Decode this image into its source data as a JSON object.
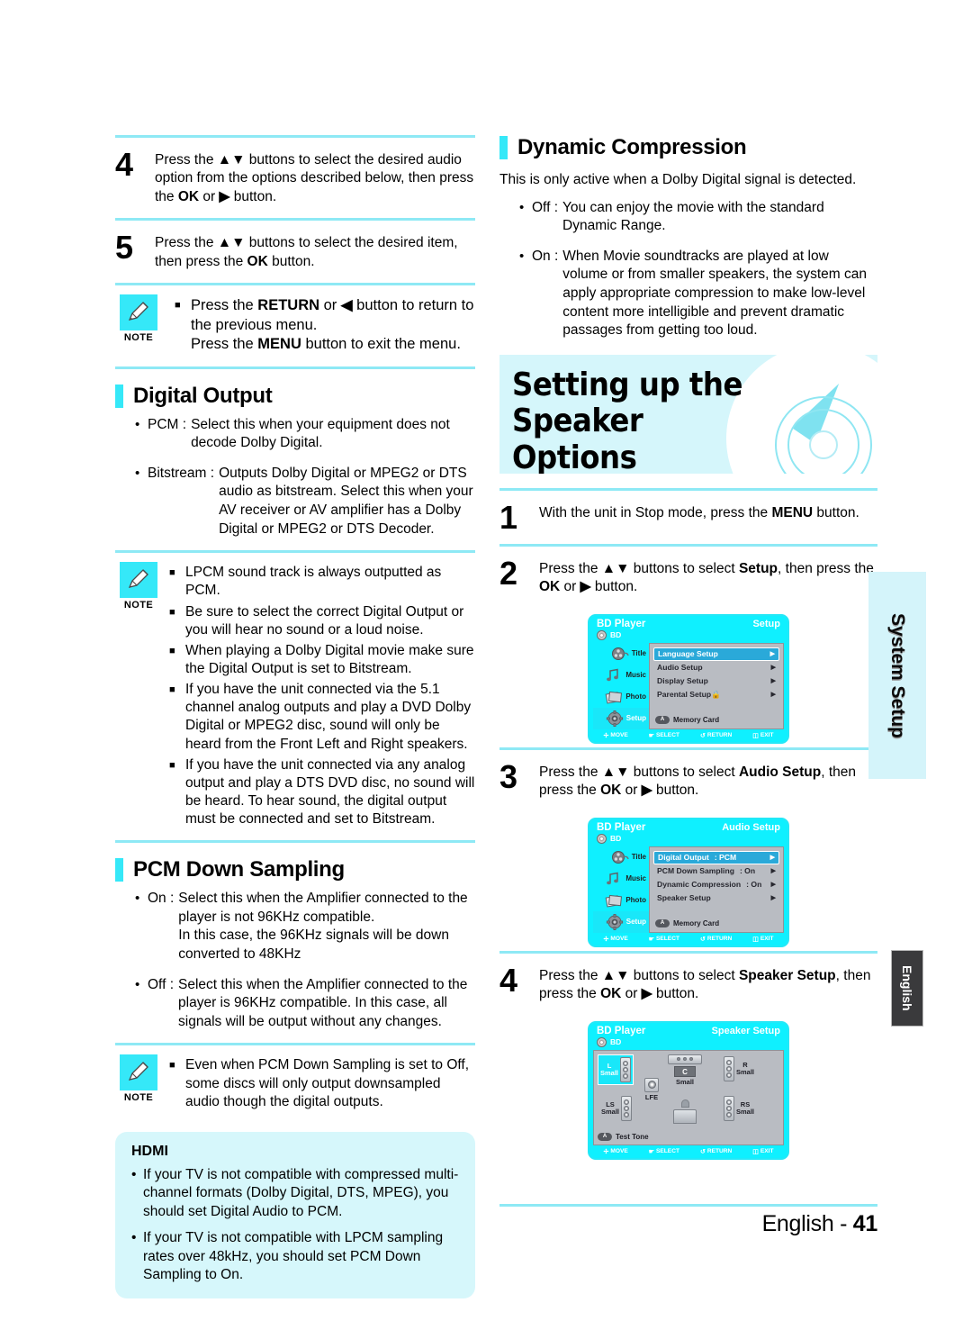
{
  "left_column": {
    "steps": [
      {
        "num": "4",
        "text_parts": [
          "Press the ",
          "▲▼",
          " buttons to select the desired audio option from the options described below, then press the ",
          "OK",
          " or ",
          "▶",
          " button."
        ]
      },
      {
        "num": "5",
        "text_parts": [
          "Press the ",
          "▲▼",
          " buttons to select the desired item, then press the ",
          "OK",
          " button."
        ]
      }
    ],
    "note1": {
      "label": "NOTE",
      "items": [
        "Press the RETURN or ◀ button to return to the previous menu.\nPress the MENU button to exit the menu."
      ]
    },
    "digital_output": {
      "heading": "Digital Output",
      "items": [
        {
          "term": "PCM :",
          "desc": "Select this when your equipment does not decode Dolby Digital."
        },
        {
          "term": "Bitstream :",
          "desc": "Outputs Dolby Digital or MPEG2 or DTS audio as bitstream. Select this when your AV receiver or AV amplifier has a Dolby Digital or MPEG2 or DTS Decoder."
        }
      ]
    },
    "note2": {
      "label": "NOTE",
      "items": [
        "LPCM sound track is always outputted as PCM.",
        "Be sure to select the correct Digital Output or you will hear no sound or a loud noise.",
        "When playing a Dolby Digital movie make sure the Digital Output is set to Bitstream.",
        "If you have the unit connected via the 5.1 channel analog outputs and play a DVD Dolby Digital or MPEG2 disc, sound will only be heard from the Front Left and Right speakers.",
        "If you have the unit connected via any analog output and play a DTS DVD disc, no sound will be heard. To hear sound, the digital output must be connected and set to Bitstream."
      ]
    },
    "pcm_down_sampling": {
      "heading": "PCM Down Sampling",
      "items": [
        {
          "term": "On :",
          "desc": "Select this when the Amplifier connected to the player is not 96KHz compatible.\nIn this case, the 96KHz signals will be down converted to 48KHz"
        },
        {
          "term": "Off :",
          "desc": "Select this when the Amplifier connected to the player is 96KHz compatible. In this case, all signals will be output without any changes."
        }
      ]
    },
    "note3": {
      "label": "NOTE",
      "items": [
        "Even when PCM Down Sampling is set to Off, some discs will only output downsampled audio though the digital outputs."
      ]
    },
    "hdmi_box": {
      "title": "HDMI",
      "items": [
        "If your TV is not compatible with compressed multi-channel formats (Dolby Digital, DTS, MPEG), you should set Digital Audio to PCM.",
        "If your TV is not compatible with LPCM sampling rates over 48kHz, you should set PCM Down Sampling to On."
      ]
    }
  },
  "right_column": {
    "dynamic_compression": {
      "heading": "Dynamic Compression",
      "intro": "This is only active when a Dolby Digital signal is detected.",
      "items": [
        {
          "term": "Off :",
          "desc": "You can enjoy the movie with the standard Dynamic Range."
        },
        {
          "term": "On :",
          "desc": "When Movie soundtracks are played at low volume or from smaller speakers, the system can apply appropriate compression to make low-level content more intelligible and prevent dramatic passages from getting too loud."
        }
      ]
    },
    "banner": {
      "title_line1": "Setting up the Speaker",
      "title_line2": "Options",
      "bg_color": "#d5f6fb"
    },
    "steps": [
      {
        "num": "1",
        "text_parts": [
          "With the unit in Stop mode, press the ",
          "MENU",
          " button."
        ]
      },
      {
        "num": "2",
        "text_parts": [
          "Press the ",
          "▲▼",
          " buttons to select ",
          "Setup",
          ", then press the ",
          "OK",
          " or ",
          "▶",
          " button."
        ]
      },
      {
        "num": "3",
        "text_parts": [
          "Press the ",
          "▲▼",
          " buttons to select ",
          "Audio Setup",
          ", then press the ",
          "OK",
          " or ",
          "▶",
          " button."
        ]
      },
      {
        "num": "4",
        "text_parts": [
          "Press the ",
          "▲▼",
          " buttons to select ",
          "Speaker Setup",
          ", then press the ",
          "OK",
          " or ",
          "▶",
          " button."
        ]
      }
    ]
  },
  "osd_common": {
    "device_title": "BD Player",
    "disc_label": "BD",
    "sidebar": [
      {
        "label": "Title",
        "icon": "film-reel-icon",
        "active": false
      },
      {
        "label": "Music",
        "icon": "music-note-icon",
        "active": false
      },
      {
        "label": "Photo",
        "icon": "photo-stack-icon",
        "active": false
      },
      {
        "label": "Setup",
        "icon": "gear-icon",
        "active": true
      }
    ],
    "memory_card": {
      "button": "A",
      "label": "Memory Card"
    },
    "footer": [
      {
        "icon": "dpad-icon",
        "label": "MOVE"
      },
      {
        "icon": "select-icon",
        "label": "SELECT"
      },
      {
        "icon": "return-icon",
        "label": "RETURN"
      },
      {
        "icon": "exit-icon",
        "label": "EXIT"
      }
    ]
  },
  "osd_setup": {
    "screen_title": "Setup",
    "rows": [
      {
        "name": "Language Setup",
        "value": "",
        "selected": true
      },
      {
        "name": "Audio Setup",
        "value": "",
        "selected": false
      },
      {
        "name": "Display Setup",
        "value": "",
        "selected": false
      },
      {
        "name": "Parental Setup",
        "value": "",
        "selected": false,
        "lock": true
      }
    ]
  },
  "osd_audio": {
    "screen_title": "Audio Setup",
    "rows": [
      {
        "name": "Digital Output",
        "value": ": PCM",
        "selected": true
      },
      {
        "name": "PCM Down Sampling",
        "value": ": On",
        "selected": false
      },
      {
        "name": "Dynamic Compression",
        "value": ": On",
        "selected": false
      },
      {
        "name": "Speaker Setup",
        "value": "",
        "selected": false
      }
    ]
  },
  "osd_speaker": {
    "screen_title": "Speaker Setup",
    "speakers": [
      {
        "id": "L",
        "label": "L\nSmall",
        "highlight": true
      },
      {
        "id": "C",
        "label": "Small",
        "center_letter": "C",
        "highlight": false
      },
      {
        "id": "R",
        "label": "R\nSmall",
        "highlight": false
      },
      {
        "id": "LS",
        "label": "LS\nSmall",
        "highlight": false
      },
      {
        "id": "LFE",
        "label": "LFE",
        "highlight": false
      },
      {
        "id": "RS",
        "label": "RS\nSmall",
        "highlight": false
      },
      {
        "id": "SUB",
        "label": "",
        "highlight": false
      }
    ],
    "test_tone": {
      "button": "A",
      "label": "Test Tone"
    }
  },
  "side_tabs": {
    "system_setup": "System Setup",
    "language": "English"
  },
  "footer": {
    "language": "English - ",
    "page": "41"
  }
}
